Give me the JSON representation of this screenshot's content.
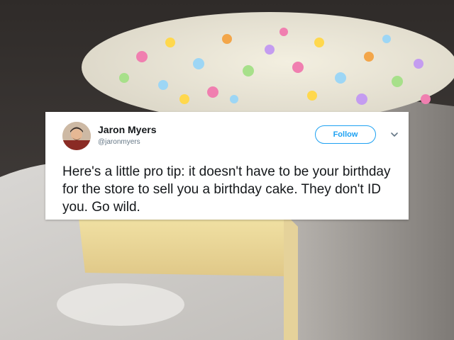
{
  "tweet": {
    "display_name": "Jaron Myers",
    "handle": "@jaronmyers",
    "follow_label": "Follow",
    "text": "Here's a little pro tip: it doesn't have to be your birthday for the store to sell you a birthday cake. They don't ID you. Go wild.",
    "accent_color": "#1da1f2"
  },
  "icons": {
    "menu": "chevron-down-icon"
  }
}
